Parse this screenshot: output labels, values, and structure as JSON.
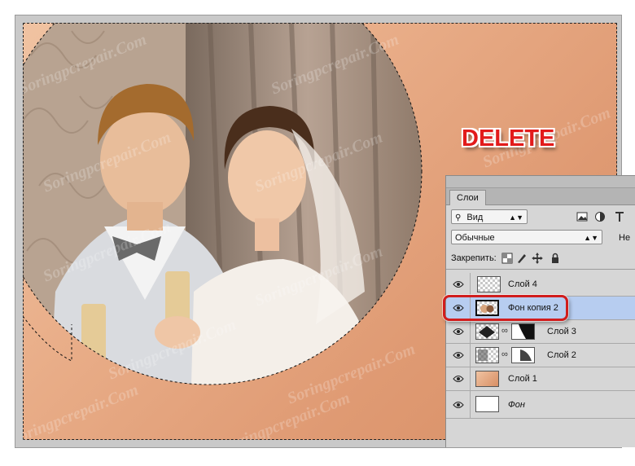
{
  "canvas": {
    "watermark": "Soringpcrepair.Com",
    "overlay_label": "DELETE"
  },
  "layers_panel": {
    "tab_label": "Слои",
    "filter_value": "Вид",
    "blend_mode": "Обычные",
    "opacity_label_partial": "Не",
    "lock_label": "Закрепить:",
    "layers": [
      {
        "name": "Слой 4",
        "thumbnail": "transparent",
        "selected": false,
        "has_mask": false,
        "italic": false
      },
      {
        "name": "Фон копия 2",
        "thumbnail": "photo-cutout",
        "selected": true,
        "has_mask": false,
        "italic": false
      },
      {
        "name": "Слой 3",
        "thumbnail": "dark-pattern",
        "selected": false,
        "has_mask": true,
        "italic": false
      },
      {
        "name": "Слой 2",
        "thumbnail": "transparent-dark",
        "selected": false,
        "has_mask": true,
        "italic": false
      },
      {
        "name": "Слой 1",
        "thumbnail": "peach-fill",
        "selected": false,
        "has_mask": false,
        "italic": false
      },
      {
        "name": "Фон",
        "thumbnail": "white",
        "selected": false,
        "has_mask": false,
        "italic": true
      }
    ]
  },
  "colors": {
    "accent_red": "#e21b1b",
    "selected_layer": "#b7cdf0",
    "peach": "#e9ae89"
  }
}
